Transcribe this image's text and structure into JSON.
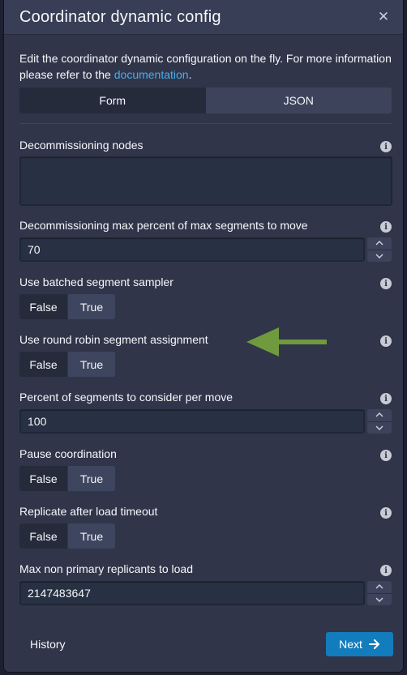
{
  "dialog": {
    "title": "Coordinator dynamic config",
    "close_icon": "close-icon"
  },
  "intro": {
    "text_before": "Edit the coordinator dynamic configuration on the fly. For more information please refer to the ",
    "link_text": "documentation",
    "text_after": "."
  },
  "view_tabs": {
    "form_label": "Form",
    "json_label": "JSON",
    "selected": "Form"
  },
  "fields": {
    "decommissioning_nodes": {
      "label": "Decommissioning nodes",
      "value": ""
    },
    "decommissioning_max_percent": {
      "label": "Decommissioning max percent of max segments to move",
      "value": "70"
    },
    "use_batched_segment_sampler": {
      "label": "Use batched segment sampler",
      "false_label": "False",
      "true_label": "True",
      "selected": "False"
    },
    "use_round_robin": {
      "label": "Use round robin segment assignment",
      "false_label": "False",
      "true_label": "True",
      "selected": "False"
    },
    "percent_segments_per_move": {
      "label": "Percent of segments to consider per move",
      "value": "100"
    },
    "pause_coordination": {
      "label": "Pause coordination",
      "false_label": "False",
      "true_label": "True",
      "selected": "False"
    },
    "replicate_after_load_timeout": {
      "label": "Replicate after load timeout",
      "false_label": "False",
      "true_label": "True",
      "selected": "False"
    },
    "max_non_primary_replicants": {
      "label": "Max non primary replicants to load",
      "value": "2147483647"
    }
  },
  "footer": {
    "history_label": "History",
    "next_label": "Next"
  },
  "colors": {
    "dialog_bg": "#30354a",
    "link": "#48aff0",
    "primary_button": "#137cbd",
    "annotation_arrow": "#6f9a3d"
  }
}
